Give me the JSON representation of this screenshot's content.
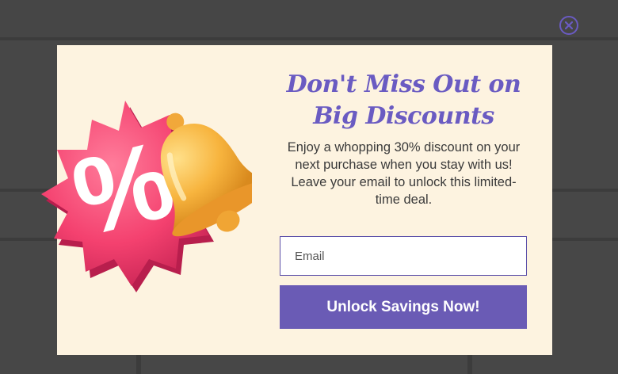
{
  "popup": {
    "headline": "Don't Miss Out on Big Discounts",
    "body": "Enjoy a whopping 30% discount on your next purchase when you stay with us! Leave your email to unlock this limited-time deal.",
    "email_placeholder": "Email",
    "cta_label": "Unlock Savings Now!",
    "illustration_text": "%"
  },
  "icons": {
    "close": "close-circle-icon",
    "illustration": "percent-badge-bell-icon"
  },
  "colors": {
    "overlay": "#474747",
    "popup_bg": "#fdf3e0",
    "accent": "#6a5bb5",
    "badge": "#f24a78",
    "bell": "#f5b640"
  }
}
